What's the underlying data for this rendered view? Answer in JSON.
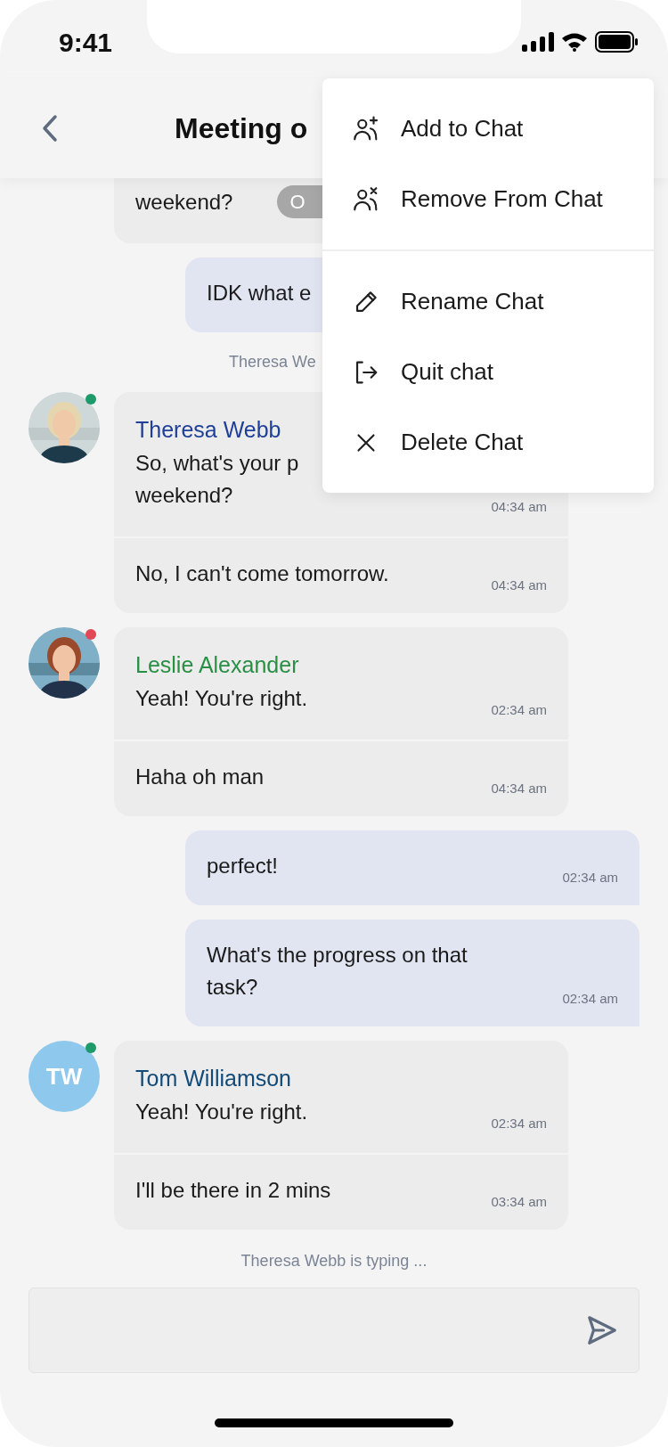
{
  "status_bar": {
    "time": "9:41"
  },
  "header": {
    "title": "Meeting o"
  },
  "messages": [
    {
      "kind": "cut_incoming",
      "lines": [
        "weekend?"
      ],
      "pill": "O"
    },
    {
      "kind": "outgoing",
      "lines": [
        "IDK what e"
      ]
    },
    {
      "kind": "cut_system",
      "text": "Theresa We"
    },
    {
      "kind": "group",
      "sender": "Theresa Webb",
      "color": "#1f3f99",
      "avatar": {
        "kind": "picture",
        "color": "#1f9a6b"
      },
      "messages": [
        {
          "lines": [
            "So, what's your p",
            "weekend?"
          ],
          "time": "04:34 am"
        },
        {
          "lines": [
            "No, I can't come tomorrow."
          ],
          "time": "04:34 am"
        }
      ]
    },
    {
      "kind": "group",
      "sender": "Leslie Alexander",
      "color": "#2a8f45",
      "avatar": {
        "kind": "picture",
        "color": "#e04858"
      },
      "messages": [
        {
          "lines": [
            "Yeah! You're right."
          ],
          "time": "02:34 am"
        },
        {
          "lines": [
            "Haha oh man"
          ],
          "time": "04:34 am"
        }
      ]
    },
    {
      "kind": "outgoing",
      "lines": [
        "perfect!"
      ],
      "time": "02:34 am"
    },
    {
      "kind": "outgoing",
      "lines": [
        "What's the progress on that",
        "task?"
      ],
      "time": "02:34 am"
    },
    {
      "kind": "group",
      "sender": "Tom Williamson",
      "color": "#124a78",
      "avatar": {
        "kind": "initials",
        "initials": "TW",
        "color": "#1f9a6b"
      },
      "messages": [
        {
          "lines": [
            "Yeah! You're right."
          ],
          "time": "02:34 am"
        },
        {
          "lines": [
            "I'll be there in 2 mins"
          ],
          "time": "03:34 am"
        }
      ]
    },
    {
      "kind": "system",
      "text": "Theresa Webb is typing ..."
    }
  ],
  "menu": {
    "groups": [
      [
        {
          "label": "Add to Chat",
          "kind": "add"
        },
        {
          "label": "Remove From Chat",
          "kind": "remove"
        }
      ],
      [
        {
          "label": "Rename Chat",
          "kind": "rename"
        },
        {
          "label": "Quit chat",
          "kind": "quit"
        },
        {
          "label": "Delete Chat",
          "kind": "delete"
        }
      ]
    ]
  }
}
